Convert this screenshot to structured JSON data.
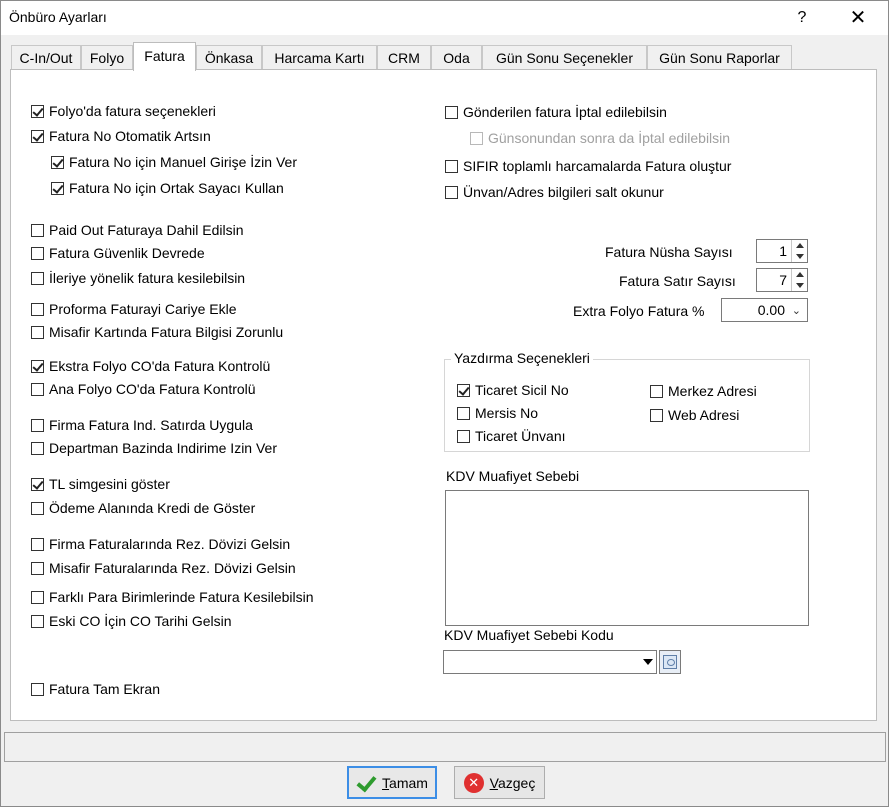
{
  "window": {
    "title": "Önbüro Ayarları",
    "help_label": "?",
    "close_label": "✕"
  },
  "tabs": [
    {
      "label": "C-In/Out"
    },
    {
      "label": "Folyo"
    },
    {
      "label": "Fatura"
    },
    {
      "label": "Önkasa"
    },
    {
      "label": "Harcama Kartı"
    },
    {
      "label": "CRM"
    },
    {
      "label": "Oda"
    },
    {
      "label": "Gün Sonu Seçenekler"
    },
    {
      "label": "Gün Sonu Raporlar"
    }
  ],
  "active_tab": "Fatura",
  "left_options": [
    {
      "label": "Folyo'da fatura seçenekleri",
      "checked": true
    },
    {
      "label": "Fatura No Otomatik Artsın",
      "checked": true
    },
    {
      "label": "Fatura No için Manuel Girişe İzin Ver",
      "checked": true
    },
    {
      "label": "Fatura No için Ortak Sayacı Kullan",
      "checked": true
    },
    {
      "label": "Paid Out Faturaya Dahil Edilsin",
      "checked": false
    },
    {
      "label": "Fatura Güvenlik Devrede",
      "checked": false
    },
    {
      "label": "İleriye yönelik fatura kesilebilsin",
      "checked": false
    },
    {
      "label": "Proforma Faturayi Cariye Ekle",
      "checked": false
    },
    {
      "label": "Misafir Kartında Fatura Bilgisi Zorunlu",
      "checked": false
    },
    {
      "label": "Ekstra Folyo CO'da Fatura Kontrolü",
      "checked": true
    },
    {
      "label": "Ana Folyo CO'da Fatura Kontrolü",
      "checked": false
    },
    {
      "label": "Firma Fatura Ind. Satırda Uygula",
      "checked": false
    },
    {
      "label": "Departman Bazinda Indirime Izin Ver",
      "checked": false
    },
    {
      "label": "TL simgesini göster",
      "checked": true
    },
    {
      "label": "Ödeme Alanında Kredi de Göster",
      "checked": false
    },
    {
      "label": "Firma Faturalarında Rez. Dövizi Gelsin",
      "checked": false
    },
    {
      "label": "Misafir Faturalarında Rez. Dövizi Gelsin",
      "checked": false
    },
    {
      "label": "Farklı Para Birimlerinde Fatura Kesilebilsin",
      "checked": false
    },
    {
      "label": "Eski CO İçin CO Tarihi Gelsin",
      "checked": false
    },
    {
      "label": "Fatura Tam Ekran",
      "checked": false
    }
  ],
  "right_options": [
    {
      "label": "Gönderilen fatura İptal edilebilsin",
      "checked": false
    },
    {
      "label": "Günsonundan sonra da İptal edilebilsin",
      "checked": false,
      "disabled": true
    },
    {
      "label": "SIFIR toplamlı harcamalarda Fatura oluştur",
      "checked": false
    },
    {
      "label": "Ünvan/Adres bilgileri salt okunur",
      "checked": false
    }
  ],
  "fields": {
    "nusha_label": "Fatura Nüsha Sayısı",
    "nusha_value": "1",
    "satir_label": "Fatura Satır Sayısı",
    "satir_value": "7",
    "extra_label": "Extra Folyo Fatura %",
    "extra_value": "0.00"
  },
  "print_group": {
    "title": "Yazdırma Seçenekleri",
    "items": [
      {
        "label": "Ticaret Sicil No",
        "checked": true
      },
      {
        "label": "Mersis No",
        "checked": false
      },
      {
        "label": "Ticaret Ünvanı",
        "checked": false
      },
      {
        "label": "Merkez Adresi",
        "checked": false
      },
      {
        "label": "Web Adresi",
        "checked": false
      }
    ]
  },
  "kdv": {
    "reason_label": "KDV Muafiyet Sebebi",
    "reason_value": "",
    "code_label": "KDV Muafiyet Sebebi Kodu",
    "code_value": ""
  },
  "buttons": {
    "ok_prefix": "",
    "ok_underlined": "T",
    "ok_rest": "amam",
    "cancel_underlined": "V",
    "cancel_rest": "azgeç"
  },
  "colors": {
    "accent": "#3c8ee6",
    "ok_icon": "#2e9b2e",
    "cancel_icon": "#e03030"
  }
}
